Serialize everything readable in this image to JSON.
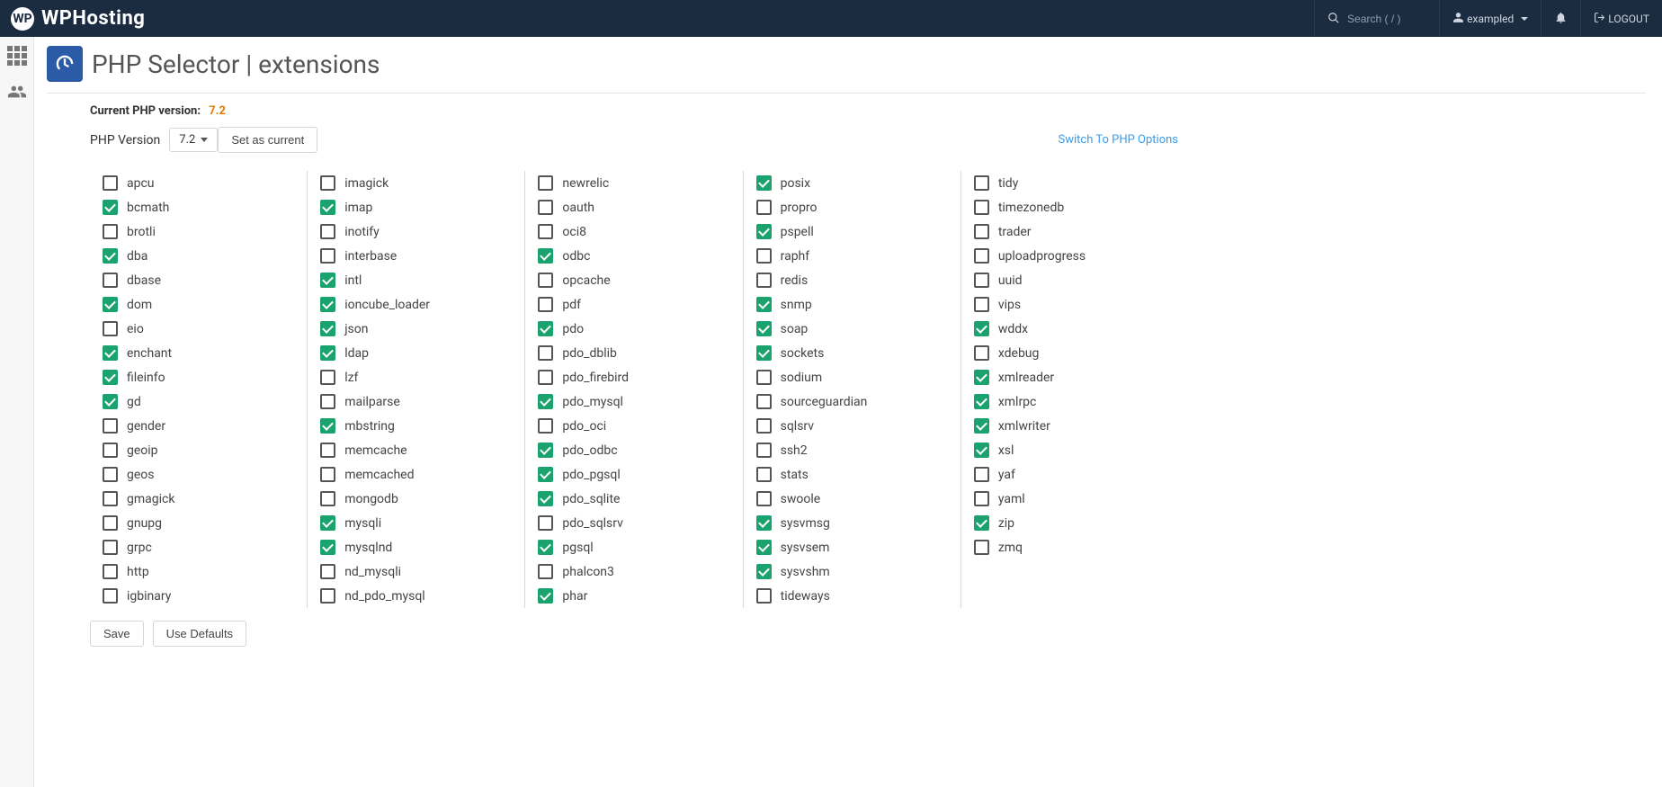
{
  "brand": {
    "name": "WPHosting",
    "logo_text": "WP"
  },
  "topbar": {
    "search_placeholder": "Search ( / )",
    "username": "exampled",
    "logout": "LOGOUT"
  },
  "page": {
    "title": "PHP Selector | extensions",
    "current_label": "Current PHP version:",
    "current_value": "7.2",
    "version_label": "PHP Version",
    "version_selected": "7.2",
    "set_current_btn": "Set as current",
    "switch_link": "Switch To PHP Options",
    "save_btn": "Save",
    "defaults_btn": "Use Defaults"
  },
  "extensions": {
    "cols": [
      [
        {
          "label": "apcu",
          "checked": false
        },
        {
          "label": "bcmath",
          "checked": true
        },
        {
          "label": "brotli",
          "checked": false
        },
        {
          "label": "dba",
          "checked": true
        },
        {
          "label": "dbase",
          "checked": false
        },
        {
          "label": "dom",
          "checked": true
        },
        {
          "label": "eio",
          "checked": false
        },
        {
          "label": "enchant",
          "checked": true
        },
        {
          "label": "fileinfo",
          "checked": true
        },
        {
          "label": "gd",
          "checked": true
        },
        {
          "label": "gender",
          "checked": false
        },
        {
          "label": "geoip",
          "checked": false
        },
        {
          "label": "geos",
          "checked": false
        },
        {
          "label": "gmagick",
          "checked": false
        },
        {
          "label": "gnupg",
          "checked": false
        },
        {
          "label": "grpc",
          "checked": false
        },
        {
          "label": "http",
          "checked": false
        },
        {
          "label": "igbinary",
          "checked": false
        }
      ],
      [
        {
          "label": "imagick",
          "checked": false
        },
        {
          "label": "imap",
          "checked": true
        },
        {
          "label": "inotify",
          "checked": false
        },
        {
          "label": "interbase",
          "checked": false
        },
        {
          "label": "intl",
          "checked": true
        },
        {
          "label": "ioncube_loader",
          "checked": true
        },
        {
          "label": "json",
          "checked": true
        },
        {
          "label": "ldap",
          "checked": true
        },
        {
          "label": "lzf",
          "checked": false
        },
        {
          "label": "mailparse",
          "checked": false
        },
        {
          "label": "mbstring",
          "checked": true
        },
        {
          "label": "memcache",
          "checked": false
        },
        {
          "label": "memcached",
          "checked": false
        },
        {
          "label": "mongodb",
          "checked": false
        },
        {
          "label": "mysqli",
          "checked": true
        },
        {
          "label": "mysqlnd",
          "checked": true
        },
        {
          "label": "nd_mysqli",
          "checked": false
        },
        {
          "label": "nd_pdo_mysql",
          "checked": false
        }
      ],
      [
        {
          "label": "newrelic",
          "checked": false
        },
        {
          "label": "oauth",
          "checked": false
        },
        {
          "label": "oci8",
          "checked": false
        },
        {
          "label": "odbc",
          "checked": true
        },
        {
          "label": "opcache",
          "checked": false
        },
        {
          "label": "pdf",
          "checked": false
        },
        {
          "label": "pdo",
          "checked": true
        },
        {
          "label": "pdo_dblib",
          "checked": false
        },
        {
          "label": "pdo_firebird",
          "checked": false
        },
        {
          "label": "pdo_mysql",
          "checked": true
        },
        {
          "label": "pdo_oci",
          "checked": false
        },
        {
          "label": "pdo_odbc",
          "checked": true
        },
        {
          "label": "pdo_pgsql",
          "checked": true
        },
        {
          "label": "pdo_sqlite",
          "checked": true
        },
        {
          "label": "pdo_sqlsrv",
          "checked": false
        },
        {
          "label": "pgsql",
          "checked": true
        },
        {
          "label": "phalcon3",
          "checked": false
        },
        {
          "label": "phar",
          "checked": true
        }
      ],
      [
        {
          "label": "posix",
          "checked": true
        },
        {
          "label": "propro",
          "checked": false
        },
        {
          "label": "pspell",
          "checked": true
        },
        {
          "label": "raphf",
          "checked": false
        },
        {
          "label": "redis",
          "checked": false
        },
        {
          "label": "snmp",
          "checked": true
        },
        {
          "label": "soap",
          "checked": true
        },
        {
          "label": "sockets",
          "checked": true
        },
        {
          "label": "sodium",
          "checked": false
        },
        {
          "label": "sourceguardian",
          "checked": false
        },
        {
          "label": "sqlsrv",
          "checked": false
        },
        {
          "label": "ssh2",
          "checked": false
        },
        {
          "label": "stats",
          "checked": false
        },
        {
          "label": "swoole",
          "checked": false
        },
        {
          "label": "sysvmsg",
          "checked": true
        },
        {
          "label": "sysvsem",
          "checked": true
        },
        {
          "label": "sysvshm",
          "checked": true
        },
        {
          "label": "tideways",
          "checked": false
        }
      ],
      [
        {
          "label": "tidy",
          "checked": false
        },
        {
          "label": "timezonedb",
          "checked": false
        },
        {
          "label": "trader",
          "checked": false
        },
        {
          "label": "uploadprogress",
          "checked": false
        },
        {
          "label": "uuid",
          "checked": false
        },
        {
          "label": "vips",
          "checked": false
        },
        {
          "label": "wddx",
          "checked": true
        },
        {
          "label": "xdebug",
          "checked": false
        },
        {
          "label": "xmlreader",
          "checked": true
        },
        {
          "label": "xmlrpc",
          "checked": true
        },
        {
          "label": "xmlwriter",
          "checked": true
        },
        {
          "label": "xsl",
          "checked": true
        },
        {
          "label": "yaf",
          "checked": false
        },
        {
          "label": "yaml",
          "checked": false
        },
        {
          "label": "zip",
          "checked": true
        },
        {
          "label": "zmq",
          "checked": false
        }
      ]
    ]
  }
}
